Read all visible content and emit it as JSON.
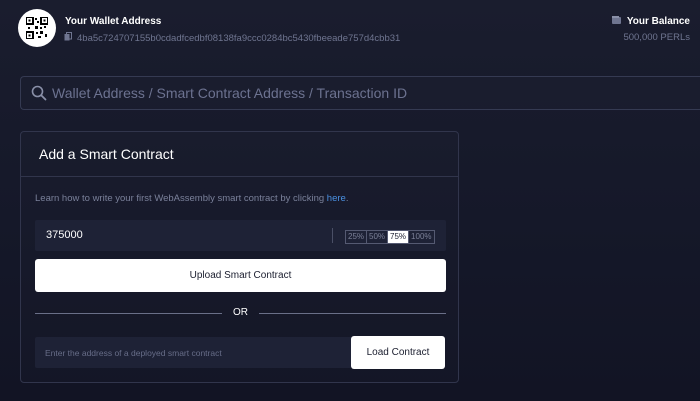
{
  "header": {
    "wallet_title": "Your Wallet Address",
    "wallet_address": "4ba5c724707155b0cdadfcedbf08138fa9ccc0284bc5430fbeeade757d4cbb31",
    "balance_title": "Your Balance",
    "balance_value": "500,000 PERLs",
    "icons": [
      "qr-code-icon",
      "copy-icon",
      "wallet-icon"
    ]
  },
  "search": {
    "placeholder": "Wallet Address / Smart Contract Address / Transaction ID",
    "icon": "search-icon"
  },
  "card": {
    "title": "Add a Smart Contract",
    "help_prefix": "Learn how to write your first WebAssembly smart contract by clicking ",
    "help_link": "here",
    "help_suffix": ".",
    "amount_value": "375000",
    "percent_options": [
      "25%",
      "50%",
      "75%",
      "100%"
    ],
    "percent_selected": "75%",
    "upload_label": "Upload Smart Contract",
    "or_label": "OR",
    "address_placeholder": "Enter the address of a deployed smart contract",
    "load_label": "Load Contract"
  },
  "colors": {
    "background": "#171a2b",
    "panel_border": "#31354c",
    "link": "#4a90e2",
    "muted_text": "#6f7590"
  }
}
